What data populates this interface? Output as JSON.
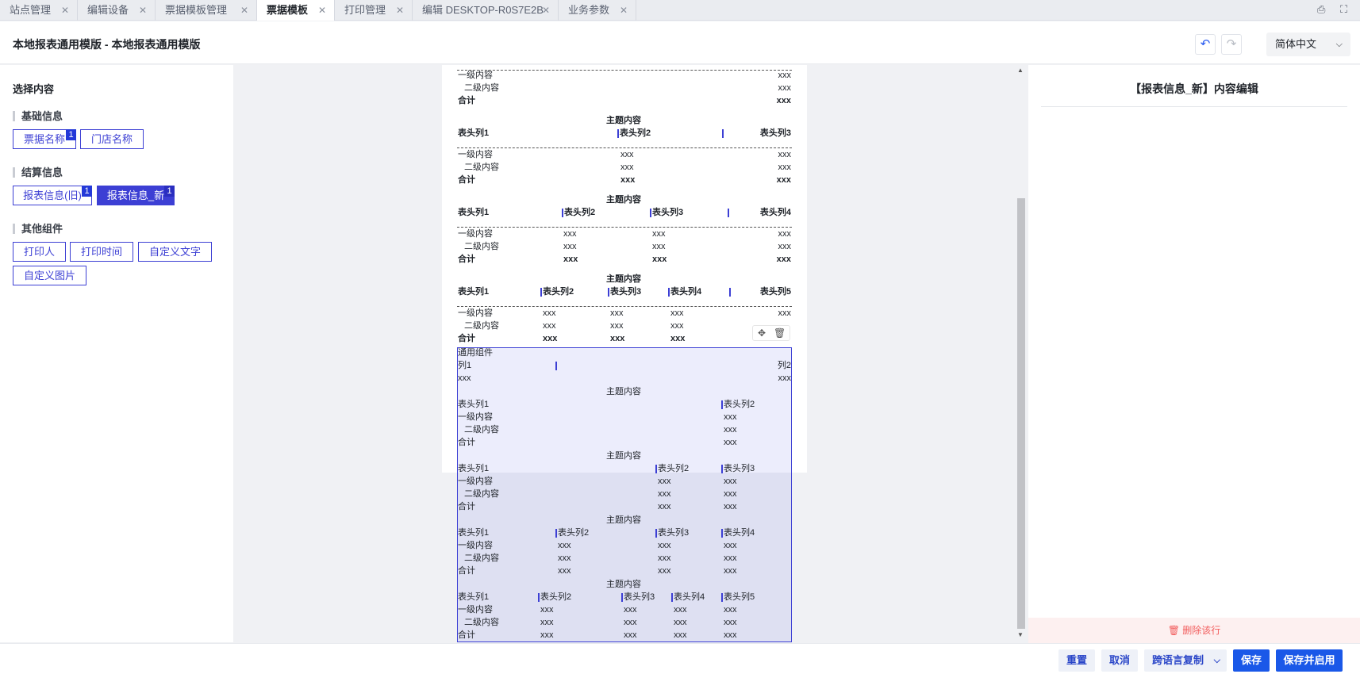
{
  "tabs": [
    {
      "label": "站点管理"
    },
    {
      "label": "编辑设备"
    },
    {
      "label": "票据模板管理"
    },
    {
      "label": "票据模板",
      "active": true
    },
    {
      "label": "打印管理"
    },
    {
      "label": "编辑 DESKTOP-R0S7E2B"
    },
    {
      "label": "业务参数"
    }
  ],
  "header": {
    "title": "本地报表通用模版 - 本地报表通用模版",
    "undo_icon": "undo-icon",
    "redo_icon": "redo-icon",
    "language": "简体中文"
  },
  "left": {
    "title": "选择内容",
    "groups": [
      {
        "name": "基础信息",
        "items": [
          {
            "label": "票据名称",
            "badge": "1"
          },
          {
            "label": "门店名称"
          }
        ]
      },
      {
        "name": "结算信息",
        "items": [
          {
            "label": "报表信息(旧)",
            "badge": "1"
          },
          {
            "label": "报表信息_新",
            "badge": "1",
            "selected": true
          }
        ]
      },
      {
        "name": "其他组件",
        "items": [
          {
            "label": "打印人"
          },
          {
            "label": "打印时间"
          },
          {
            "label": "自定义文字"
          },
          {
            "label": "自定义图片"
          }
        ]
      }
    ]
  },
  "doc": {
    "level1": "一级内容",
    "level2": "二级内容",
    "total": "合计",
    "theme": "主题内容",
    "cell": "xxx",
    "h1": "表头列1",
    "h2": "表头列2",
    "h3": "表头列3",
    "h4": "表头列4",
    "h5": "表头列5",
    "common": "通用组件",
    "col1": "列1",
    "col2": "列2"
  },
  "right": {
    "title": "【报表信息_新】内容编辑",
    "delete_row": "删除该行"
  },
  "footer": {
    "reset": "重置",
    "cancel": "取消",
    "copy_lang": "跨语言复制",
    "save": "保存",
    "save_enable": "保存并启用"
  }
}
